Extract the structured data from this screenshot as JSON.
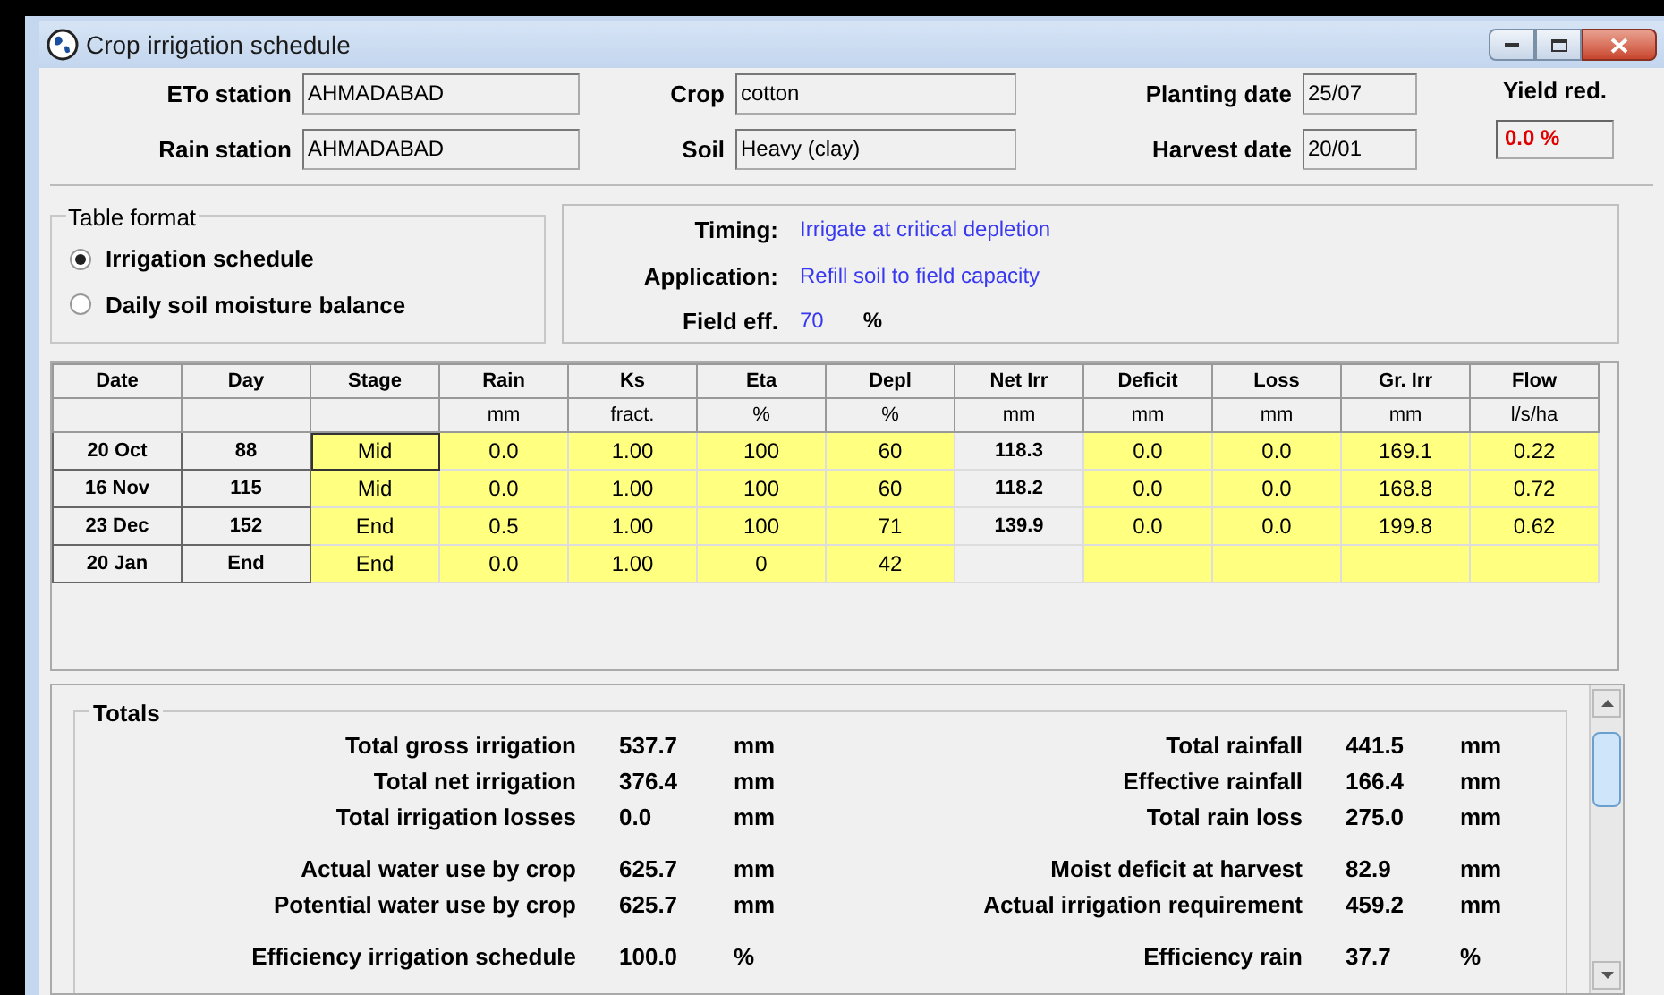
{
  "window": {
    "title": "Crop irrigation schedule"
  },
  "header": {
    "fields": [
      {
        "label": "ETo station",
        "value": "AHMADABAD"
      },
      {
        "label": "Crop",
        "value": "cotton"
      },
      {
        "label": "Planting date",
        "value": "25/07"
      },
      {
        "label": "Rain station",
        "value": "AHMADABAD"
      },
      {
        "label": "Soil",
        "value": "Heavy (clay)"
      },
      {
        "label": "Harvest date",
        "value": "20/01"
      }
    ],
    "yield_reduction": {
      "label": "Yield red.",
      "value": "0.0 %"
    }
  },
  "table_format": {
    "title": "Table format",
    "options": [
      {
        "label": "Irrigation schedule",
        "selected": true
      },
      {
        "label": "Daily soil moisture balance",
        "selected": false
      }
    ]
  },
  "settings": [
    {
      "label": "Timing:",
      "value": "Irrigate at critical depletion"
    },
    {
      "label": "Application:",
      "value": "Refill soil to field capacity"
    },
    {
      "label": "Field eff.",
      "value": "70",
      "unit": "%"
    }
  ],
  "table": {
    "columns": [
      {
        "label": "Date",
        "kind": "key"
      },
      {
        "label": "Day",
        "kind": "key"
      },
      {
        "label": "Stage",
        "kind": "input"
      },
      {
        "label": "Rain",
        "unit": "mm",
        "kind": "input"
      },
      {
        "label": "Ks",
        "unit": "fract.",
        "kind": "input"
      },
      {
        "label": "Eta",
        "unit": "%",
        "kind": "input"
      },
      {
        "label": "Depl",
        "unit": "%",
        "kind": "input"
      },
      {
        "label": "Net Irr",
        "unit": "mm",
        "kind": "output"
      },
      {
        "label": "Deficit",
        "unit": "mm",
        "kind": "input"
      },
      {
        "label": "Loss",
        "unit": "mm",
        "kind": "input"
      },
      {
        "label": "Gr. Irr",
        "unit": "mm",
        "kind": "input"
      },
      {
        "label": "Flow",
        "unit": "l/s/ha",
        "kind": "input"
      }
    ],
    "rows": [
      {
        "selected": true,
        "cells": [
          "20 Oct",
          "88",
          "Mid",
          "0.0",
          "1.00",
          "100",
          "60",
          "118.3",
          "0.0",
          "0.0",
          "169.1",
          "0.22"
        ]
      },
      {
        "selected": false,
        "cells": [
          "16 Nov",
          "115",
          "Mid",
          "0.0",
          "1.00",
          "100",
          "60",
          "118.2",
          "0.0",
          "0.0",
          "168.8",
          "0.72"
        ]
      },
      {
        "selected": false,
        "cells": [
          "23 Dec",
          "152",
          "End",
          "0.5",
          "1.00",
          "100",
          "71",
          "139.9",
          "0.0",
          "0.0",
          "199.8",
          "0.62"
        ]
      },
      {
        "selected": false,
        "cells": [
          "20 Jan",
          "End",
          "End",
          "0.0",
          "1.00",
          "0",
          "42"
        ]
      }
    ]
  },
  "totals": {
    "title": "Totals",
    "left": [
      [
        {
          "label": "Total gross irrigation",
          "value": "537.7",
          "unit": "mm"
        },
        {
          "label": "Total net irrigation",
          "value": "376.4",
          "unit": "mm"
        },
        {
          "label": "Total irrigation losses",
          "value": "0.0",
          "unit": "mm"
        }
      ],
      [
        {
          "label": "Actual water use by crop",
          "value": "625.7",
          "unit": "mm"
        },
        {
          "label": "Potential water use by crop",
          "value": "625.7",
          "unit": "mm"
        }
      ],
      [
        {
          "label": "Efficiency irrigation schedule",
          "value": "100.0",
          "unit": "%"
        }
      ]
    ],
    "right": [
      [
        {
          "label": "Total rainfall",
          "value": "441.5",
          "unit": "mm"
        },
        {
          "label": "Effective rainfall",
          "value": "166.4",
          "unit": "mm"
        },
        {
          "label": "Total rain loss",
          "value": "275.0",
          "unit": "mm"
        }
      ],
      [
        {
          "label": "Moist deficit at harvest",
          "value": "82.9",
          "unit": "mm"
        },
        {
          "label": "Actual irrigation requirement",
          "value": "459.2",
          "unit": "mm"
        }
      ],
      [
        {
          "label": "Efficiency rain",
          "value": "37.7",
          "unit": "%"
        }
      ]
    ]
  }
}
